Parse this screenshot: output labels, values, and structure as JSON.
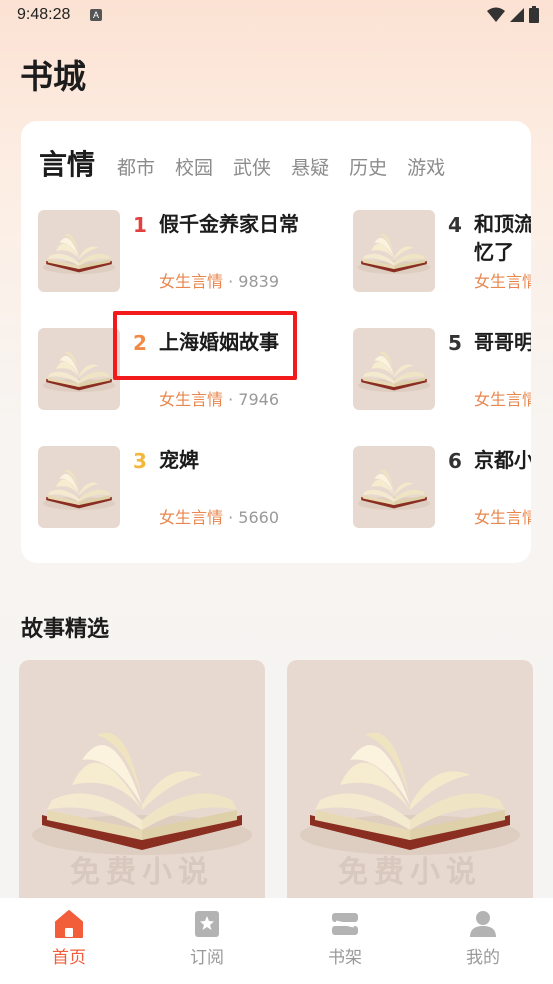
{
  "status_bar": {
    "time": "9:48:28",
    "indicator": "A"
  },
  "page_title": "书城",
  "rank_tabs": [
    {
      "label": "言情",
      "active": true
    },
    {
      "label": "都市",
      "active": false
    },
    {
      "label": "校园",
      "active": false
    },
    {
      "label": "武侠",
      "active": false
    },
    {
      "label": "悬疑",
      "active": false
    },
    {
      "label": "历史",
      "active": false
    },
    {
      "label": "游戏",
      "active": false
    }
  ],
  "ranking": [
    {
      "rank": "1",
      "title": "假千金养家日常",
      "genre": "女生言情",
      "count": " · 9839",
      "rank_color": "#e33f3f"
    },
    {
      "rank": "2",
      "title": "上海婚姻故事",
      "genre": "女生言情",
      "count": " · 7946",
      "rank_color": "#f08a46"
    },
    {
      "rank": "3",
      "title": "宠婢",
      "genre": "女生言情",
      "count": " · 5660",
      "rank_color": "#f3b73c"
    },
    {
      "rank": "4",
      "title": "和顶流\n忆了",
      "genre": "女生言情",
      "count": "",
      "rank_color": "#333333"
    },
    {
      "rank": "5",
      "title": "哥哥明",
      "genre": "女生言情",
      "count": "",
      "rank_color": "#333333"
    },
    {
      "rank": "6",
      "title": "京都小",
      "genre": "女生言情",
      "count": "",
      "rank_color": "#333333"
    }
  ],
  "cover_watermark": "免费小说",
  "story_section": {
    "title": "故事精选"
  },
  "bottom_nav": [
    {
      "label": "首页",
      "icon": "home-icon",
      "active": true
    },
    {
      "label": "订阅",
      "icon": "bookmark-icon",
      "active": false
    },
    {
      "label": "书架",
      "icon": "bookshelf-icon",
      "active": false
    },
    {
      "label": "我的",
      "icon": "profile-icon",
      "active": false
    }
  ],
  "colors": {
    "accent": "#f25d3a",
    "genre": "#e8874e",
    "highlight": "#f21a1a"
  }
}
